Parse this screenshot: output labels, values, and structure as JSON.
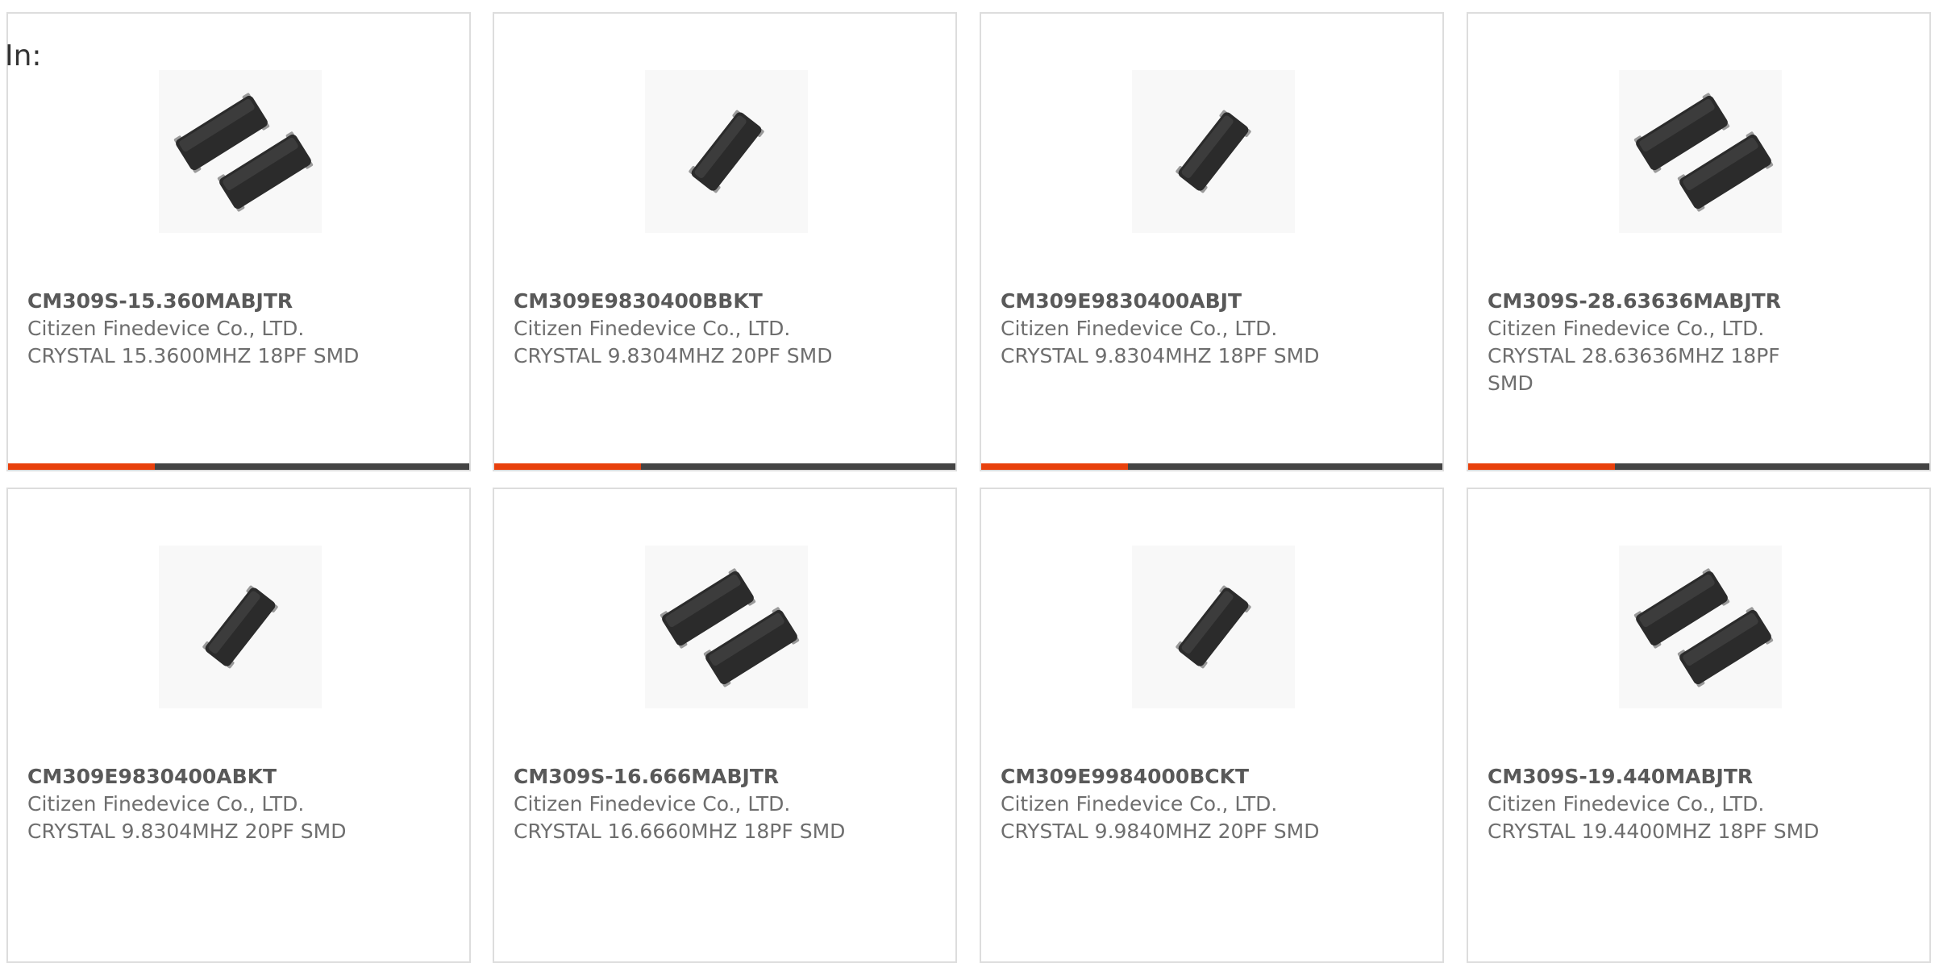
{
  "filter": {
    "label": "In:"
  },
  "products": [
    {
      "part_number": "CM309S-15.360MABJTR",
      "manufacturer": "Citizen Finedevice Co., LTD.",
      "description": "CRYSTAL 15.3600MHZ 18PF SMD",
      "image": "crystal-pair",
      "accent_bar": true
    },
    {
      "part_number": "CM309E9830400BBKT",
      "manufacturer": "Citizen Finedevice Co., LTD.",
      "description": "CRYSTAL 9.8304MHZ 20PF SMD",
      "image": "crystal-single",
      "accent_bar": true
    },
    {
      "part_number": "CM309E9830400ABJT",
      "manufacturer": "Citizen Finedevice Co., LTD.",
      "description": "CRYSTAL 9.8304MHZ 18PF SMD",
      "image": "crystal-single",
      "accent_bar": true
    },
    {
      "part_number": "CM309S-28.63636MABJTR",
      "manufacturer": "Citizen Finedevice Co., LTD.",
      "description": "CRYSTAL 28.63636MHZ 18PF SMD",
      "image": "crystal-pair",
      "accent_bar": true
    },
    {
      "part_number": "CM309E9830400ABKT",
      "manufacturer": "Citizen Finedevice Co., LTD.",
      "description": "CRYSTAL 9.8304MHZ 20PF SMD",
      "image": "crystal-single",
      "accent_bar": false
    },
    {
      "part_number": "CM309S-16.666MABJTR",
      "manufacturer": "Citizen Finedevice Co., LTD.",
      "description": "CRYSTAL 16.6660MHZ 18PF SMD",
      "image": "crystal-pair",
      "accent_bar": false
    },
    {
      "part_number": "CM309E9984000BCKT",
      "manufacturer": "Citizen Finedevice Co., LTD.",
      "description": "CRYSTAL 9.9840MHZ 20PF SMD",
      "image": "crystal-single",
      "accent_bar": false
    },
    {
      "part_number": "CM309S-19.440MABJTR",
      "manufacturer": "Citizen Finedevice Co., LTD.",
      "description": "CRYSTAL 19.4400MHZ 18PF SMD",
      "image": "crystal-pair",
      "accent_bar": false
    }
  ],
  "colors": {
    "accent": "#e8400c",
    "bar": "#444444",
    "border": "#dddddd",
    "text": "#666666"
  }
}
